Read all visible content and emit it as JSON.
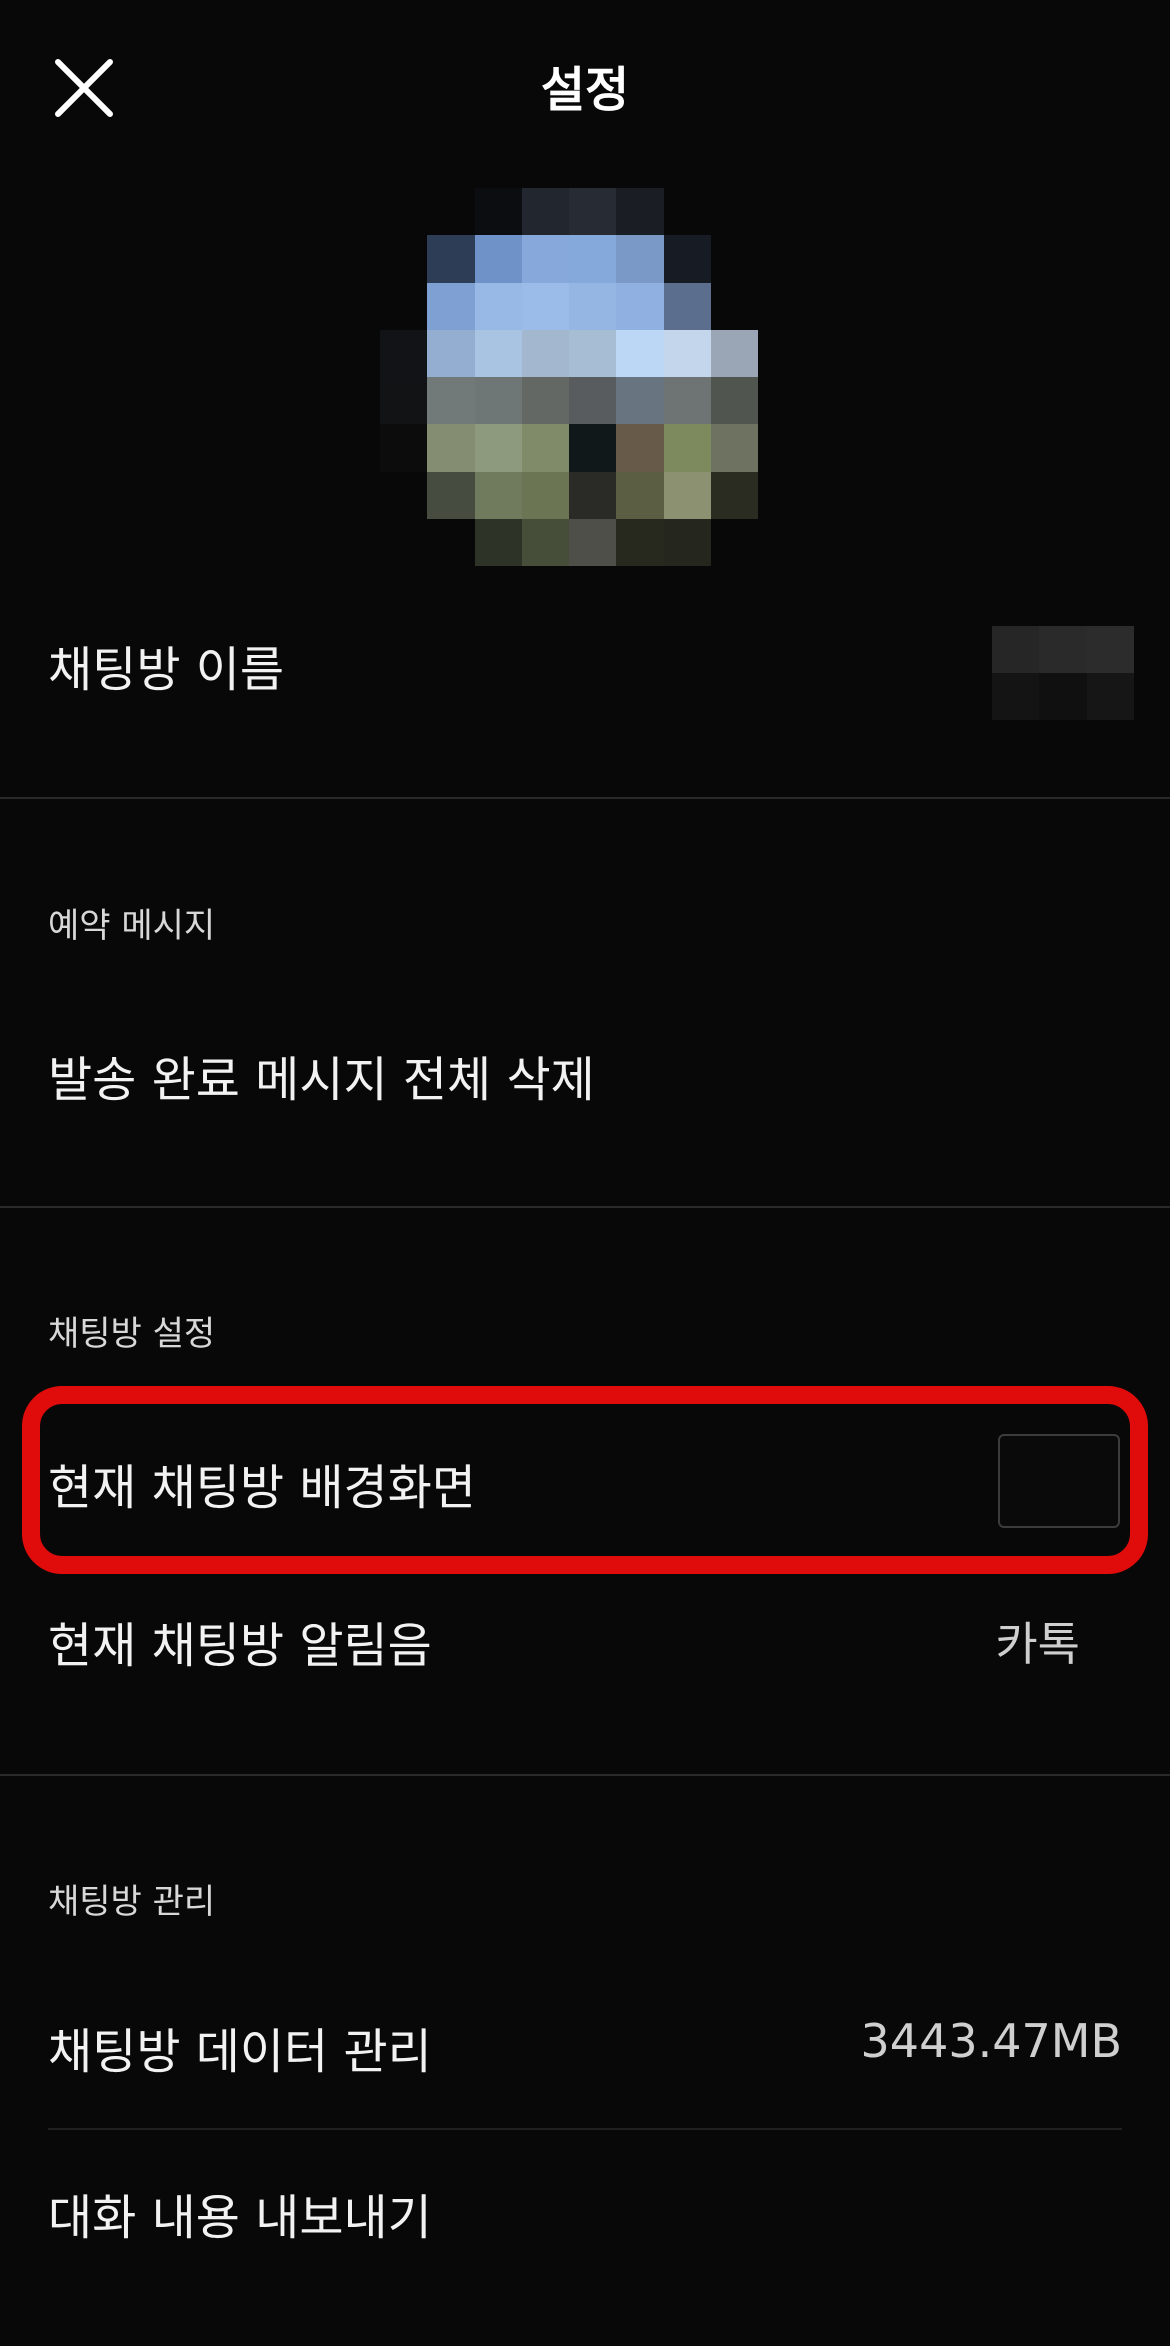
{
  "header": {
    "title": "설정",
    "close_icon": "close-icon"
  },
  "profile": {
    "avatar_colors": [
      [
        "#080808",
        "#080808",
        "#0c0d10",
        "#22262e",
        "#262b34",
        "#1a1d24",
        "#080808",
        "#080808"
      ],
      [
        "#080808",
        "#2e3d56",
        "#6f93c8",
        "#86a8db",
        "#86a9dc",
        "#7a99c7",
        "#161b24",
        "#080808"
      ],
      [
        "#080808",
        "#7ea0d2",
        "#98b8e6",
        "#9bbbe8",
        "#95b6e3",
        "#8fb0e0",
        "#5b6e8e",
        "#080808"
      ],
      [
        "#111316",
        "#93aed1",
        "#a9c3e3",
        "#a3b8cf",
        "#a6bdd4",
        "#bcd6f5",
        "#c3d6ec",
        "#9aa6b5"
      ],
      [
        "#121314",
        "#727979",
        "#6e7775",
        "#646864",
        "#595c5e",
        "#687480",
        "#6e7474",
        "#50564f"
      ],
      [
        "#0c0c0d",
        "#848d71",
        "#8e9a7e",
        "#7f8b69",
        "#10181a",
        "#675a48",
        "#7d8a5d",
        "#6e7260"
      ],
      [
        "#080808",
        "#464c3f",
        "#707a5d",
        "#6b7554",
        "#2a2b27",
        "#5c5e44",
        "#8b9171",
        "#2a2c22"
      ],
      [
        "#080808",
        "#080808",
        "#2d3427",
        "#464e3a",
        "#4e4f49",
        "#27291f",
        "#25271f",
        "#080808"
      ]
    ],
    "name_blur_colors": [
      "#262626",
      "#2a2a2a",
      "#2c2c2c",
      "#141414",
      "#101010",
      "#161616"
    ]
  },
  "rows": {
    "chat_room_name": {
      "label": "채팅방 이름"
    },
    "scheduled_section": {
      "label": "예약 메시지"
    },
    "delete_sent": {
      "label": "발송 완료 메시지 전체 삭제"
    },
    "chat_settings_section": {
      "label": "채팅방 설정"
    },
    "wallpaper": {
      "label": "현재 채팅방 배경화면"
    },
    "notification_sound": {
      "label": "현재 채팅방 알림음",
      "value": "카톡"
    },
    "chat_management_section": {
      "label": "채팅방 관리"
    },
    "data_management": {
      "label": "채팅방 데이터 관리",
      "value": "3443.47MB"
    },
    "export": {
      "label": "대화 내용 내보내기"
    }
  },
  "colors": {
    "highlight": "#e00b0b",
    "background": "#080808"
  }
}
